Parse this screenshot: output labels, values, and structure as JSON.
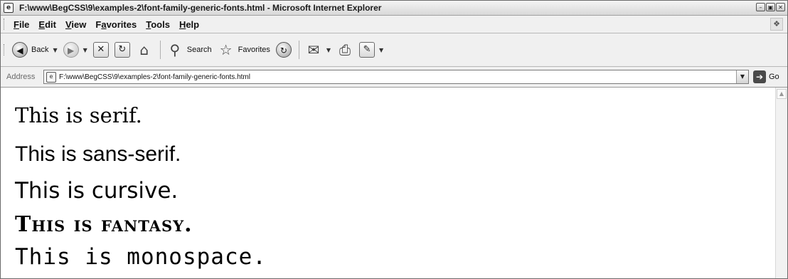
{
  "window": {
    "title": "F:\\www\\BegCSS\\9\\examples-2\\font-family-generic-fonts.html - Microsoft Internet Explorer"
  },
  "menu": {
    "items": [
      {
        "pre": "",
        "u": "F",
        "post": "ile"
      },
      {
        "pre": "",
        "u": "E",
        "post": "dit"
      },
      {
        "pre": "",
        "u": "V",
        "post": "iew"
      },
      {
        "pre": "F",
        "u": "a",
        "post": "vorites"
      },
      {
        "pre": "",
        "u": "T",
        "post": "ools"
      },
      {
        "pre": "",
        "u": "H",
        "post": "elp"
      }
    ]
  },
  "toolbar": {
    "back_label": "Back",
    "search_label": "Search",
    "favorites_label": "Favorites"
  },
  "address": {
    "label": "Address",
    "value": "F:\\www\\BegCSS\\9\\examples-2\\font-family-generic-fonts.html",
    "go_label": "Go"
  },
  "content": {
    "lines": [
      "This is serif.",
      "This is sans-serif.",
      "This is cursive.",
      "This is fantasy.",
      "This is monospace."
    ]
  },
  "icons": {
    "app": "ie-icon",
    "back": "back-arrow-icon",
    "forward": "forward-arrow-icon",
    "stop": "stop-icon",
    "refresh": "refresh-icon",
    "home": "home-icon",
    "search": "search-icon",
    "favorites": "favorites-star-icon",
    "history": "history-icon",
    "mail": "mail-icon",
    "print": "print-icon",
    "edit": "edit-icon",
    "go": "go-arrow-icon"
  }
}
